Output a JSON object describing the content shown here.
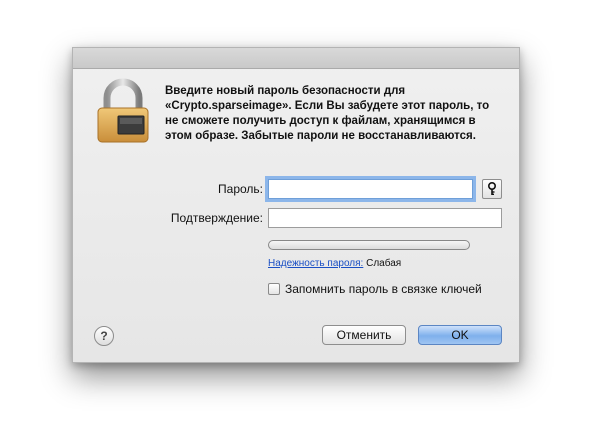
{
  "dialog": {
    "message": "Введите новый пароль безопасности для «Crypto.sparseimage». Если Вы забудете этот пароль, то не сможете получить доступ к файлам, хранящимся в этом образе. Забытые пароли не восстанавливаются.",
    "icon": "lock-icon"
  },
  "form": {
    "password_label": "Пароль:",
    "password_value": "",
    "confirm_label": "Подтверждение:",
    "confirm_value": "",
    "key_button_icon": "key-icon",
    "strength_link": "Надежность пароля:",
    "strength_value": "Слабая",
    "strength_level": 0,
    "remember_label": "Запомнить пароль в связке ключей",
    "remember_checked": false
  },
  "buttons": {
    "help_label": "?",
    "cancel_label": "Отменить",
    "ok_label": "OK"
  }
}
